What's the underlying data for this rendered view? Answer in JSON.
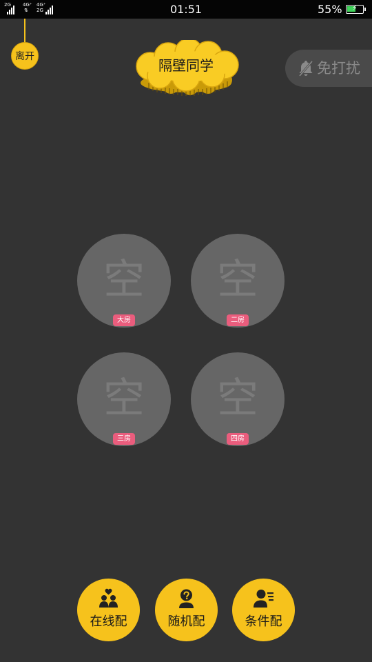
{
  "status_bar": {
    "network_left": "2G",
    "network_mid_top": "4G⁺",
    "network_mid_bottom": "⇅",
    "network_right_top": "4G⁺",
    "network_right_bottom": "2G",
    "time": "01:51",
    "battery_percent": "55%",
    "battery_level": 0.55,
    "battery_color": "#3fd35a"
  },
  "header": {
    "leave_label": "离开",
    "title": "隔壁同学",
    "dnd_label": "免打扰"
  },
  "rooms": [
    {
      "empty_label": "空",
      "tag": "大房"
    },
    {
      "empty_label": "空",
      "tag": "二房"
    },
    {
      "empty_label": "空",
      "tag": "三房"
    },
    {
      "empty_label": "空",
      "tag": "四房"
    }
  ],
  "actions": [
    {
      "label": "在线配",
      "icon": "couple-heart-icon"
    },
    {
      "label": "随机配",
      "icon": "random-user-question-icon"
    },
    {
      "label": "条件配",
      "icon": "user-filter-icon"
    }
  ],
  "colors": {
    "background": "#333333",
    "accent": "#f6c21c",
    "room_circle": "#666666",
    "room_tag": "#ea5d7d"
  }
}
